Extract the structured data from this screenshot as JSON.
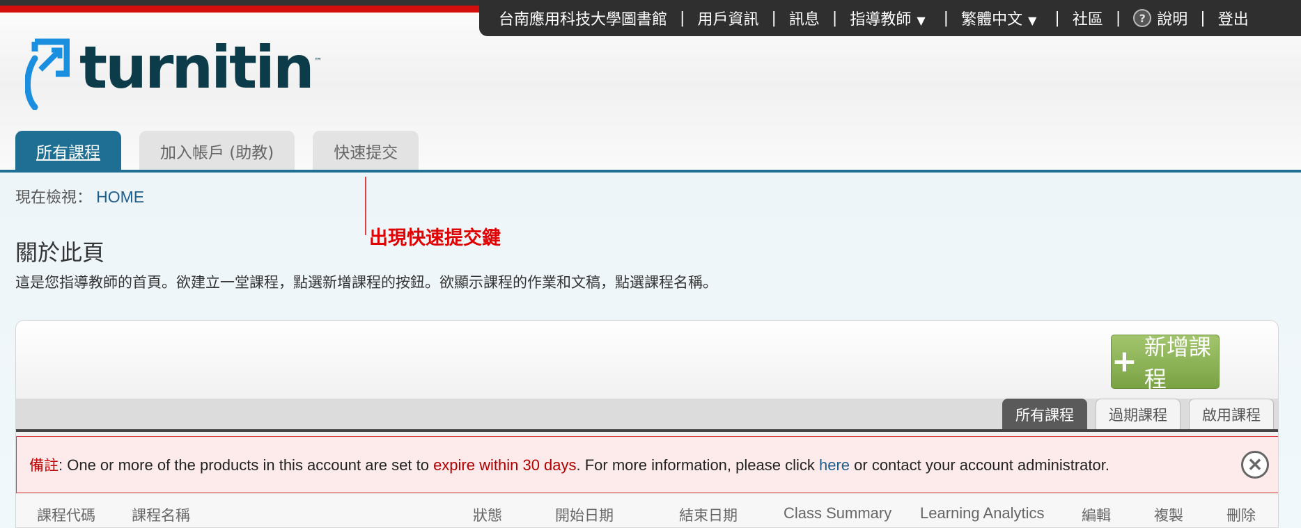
{
  "topnav": {
    "institution": "台南應用科技大學圖書館",
    "user_info": "用戶資訊",
    "messages": "訊息",
    "role": "指導教師",
    "role_arrow": "▼",
    "language": "繁體中文",
    "language_arrow": "▼",
    "community": "社區",
    "help_icon": "?",
    "help": "說明",
    "logout": "登出",
    "separator": "|"
  },
  "logo": {
    "text": "turnitin",
    "tm": "™"
  },
  "main_tabs": [
    {
      "label": "所有課程",
      "active": true
    },
    {
      "label": "加入帳戶 (助教)",
      "active": false
    },
    {
      "label": "快速提交",
      "active": false
    }
  ],
  "breadcrumb": {
    "prefix": "現在檢視：",
    "current": "HOME"
  },
  "annotation": {
    "text": "出現快速提交鍵"
  },
  "about": {
    "title": "關於此頁",
    "description": "這是您指導教師的首頁。欲建立一堂課程，點選新增課程的按鈕。欲顯示課程的作業和文稿，點選課程名稱。"
  },
  "add_course_button": {
    "icon": "+",
    "label": "新增課程"
  },
  "filter_tabs": [
    {
      "label": "所有課程",
      "active": true
    },
    {
      "label": "過期課程",
      "active": false
    },
    {
      "label": "啟用課程",
      "active": false
    }
  ],
  "notice": {
    "label": "備註",
    "part1": ": One or more of the products in this account are set to ",
    "warning": "expire within 30 days",
    "part2": ". For more information, please click ",
    "link": "here",
    "part3": " or contact your account administrator.",
    "close_icon": "✕"
  },
  "table_headers": {
    "course_id": "課程代碼",
    "course_name": "課程名稱",
    "status": "狀態",
    "start_date": "開始日期",
    "end_date": "結束日期",
    "class_summary": "Class Summary",
    "learning_analytics": "Learning Analytics",
    "edit": "編輯",
    "copy": "複製",
    "delete": "刪除"
  },
  "colors": {
    "brand_blue": "#1e6f93",
    "red_stripe": "#d40d0d",
    "add_green": "#8ab356",
    "notice_red": "#c00000"
  }
}
